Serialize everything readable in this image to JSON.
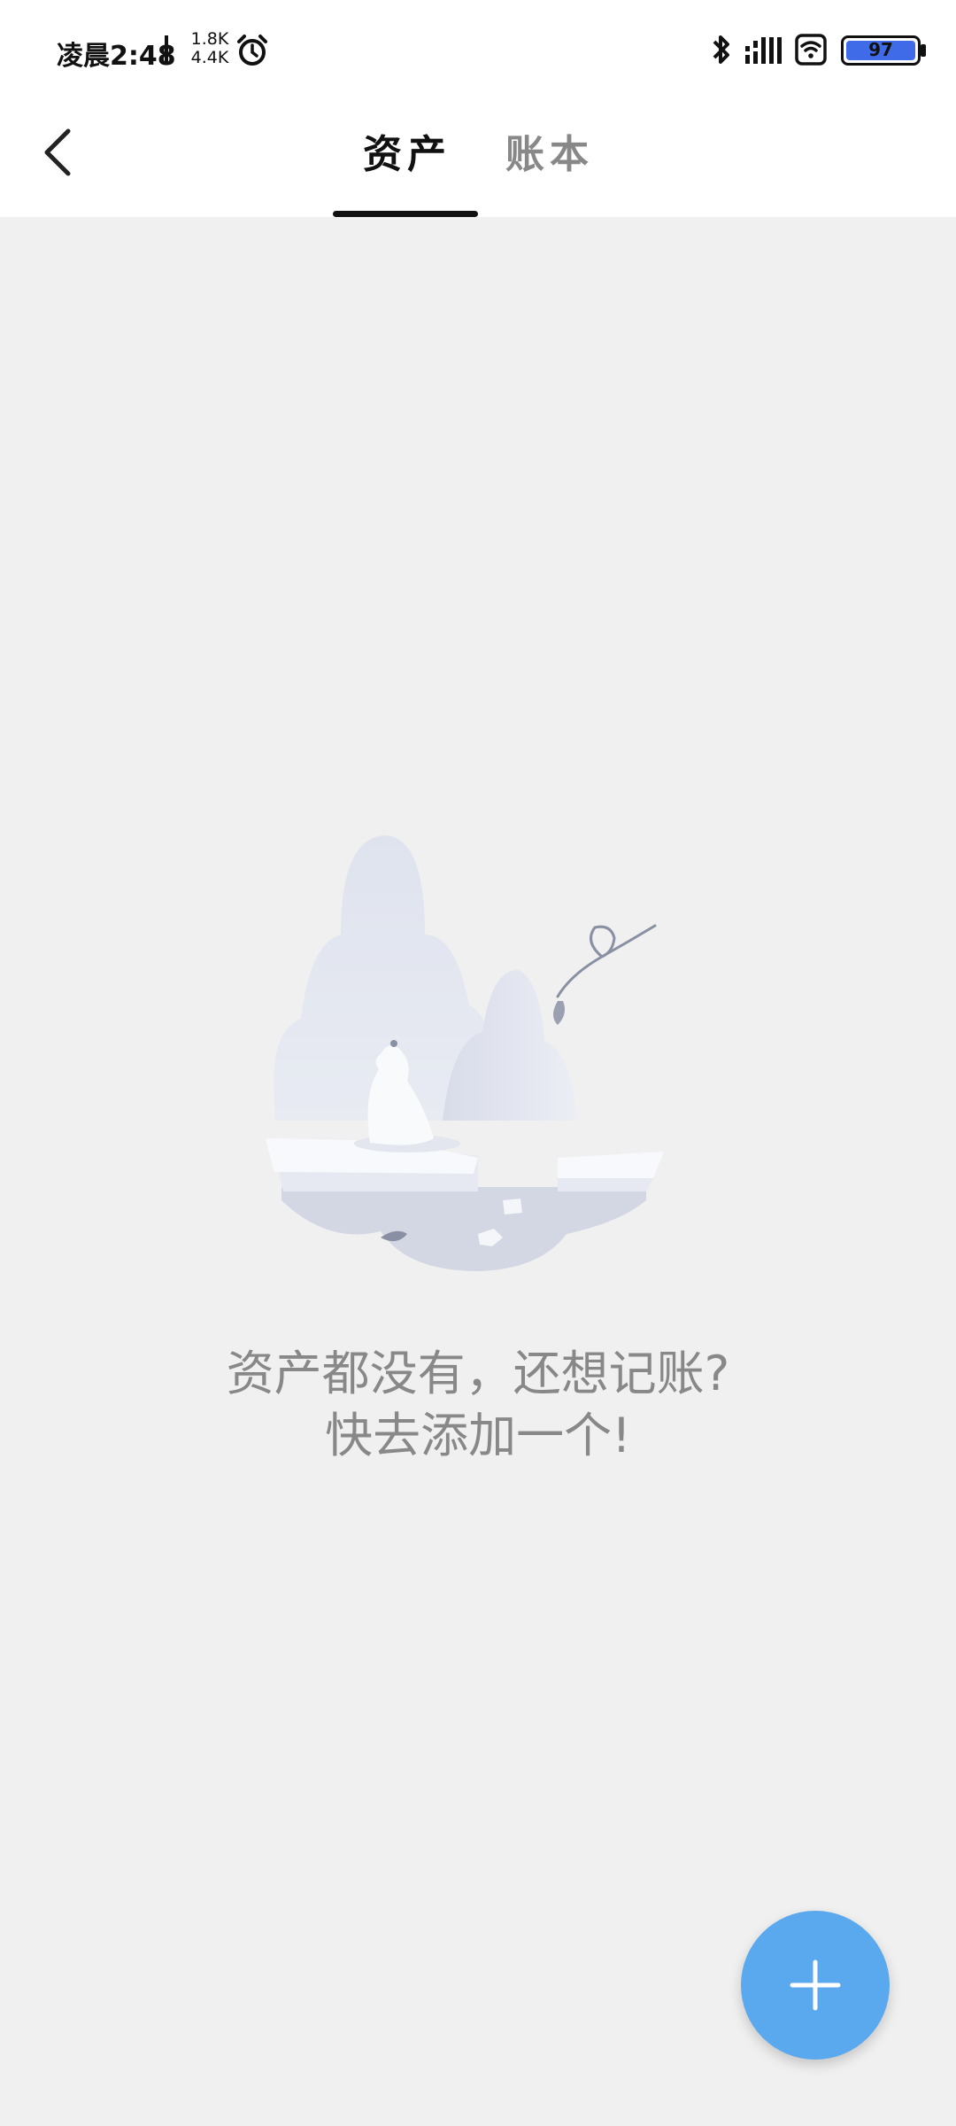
{
  "status_bar": {
    "time": "凌晨2:48",
    "net_speed_up": "1.8K",
    "net_speed_down": "4.4K",
    "battery_level": "97",
    "icons": [
      "alarm-icon",
      "bluetooth-icon",
      "signal-icon",
      "wifi-icon",
      "battery-icon"
    ]
  },
  "header": {
    "tabs": [
      {
        "label": "资产",
        "active": true
      },
      {
        "label": "账本",
        "active": false
      }
    ]
  },
  "empty_state": {
    "line1": "资产都没有，还想记账?",
    "line2": "快去添加一个!"
  },
  "fab": {
    "icon": "plus-icon",
    "color": "#5aa9ee"
  },
  "colors": {
    "background": "#f0f0f0",
    "active_tab": "#111111",
    "inactive_tab": "#888888"
  }
}
